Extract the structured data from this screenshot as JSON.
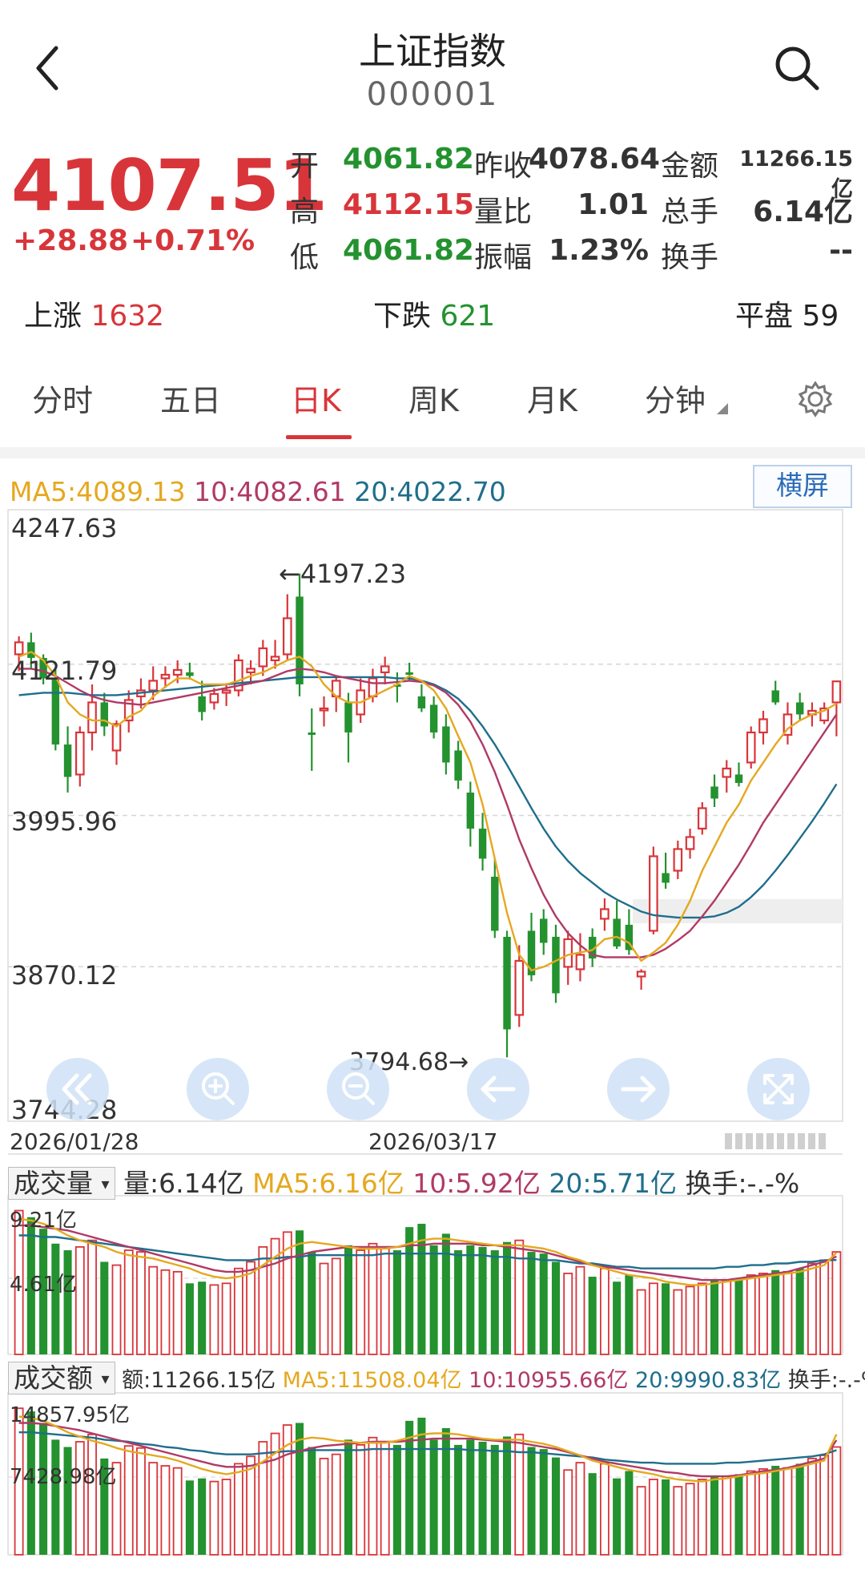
{
  "header": {
    "title": "上证指数",
    "code": "000001"
  },
  "quote": {
    "price": "4107.51",
    "change": "+28.88",
    "change_pct": "+0.71%",
    "rows": [
      {
        "l1": "开",
        "v1": "4061.82",
        "c1": "#23922f",
        "l2": "昨收",
        "v2": "4078.64",
        "l3": "金额",
        "v3": "11266.15亿"
      },
      {
        "l1": "高",
        "v1": "4112.15",
        "c1": "#d8353a",
        "l2": "量比",
        "v2": "1.01",
        "l3": "总手",
        "v3": "6.14亿"
      },
      {
        "l1": "低",
        "v1": "4061.82",
        "c1": "#23922f",
        "l2": "振幅",
        "v2": "1.23%",
        "l3": "换手",
        "v3": "--"
      }
    ]
  },
  "breadth": {
    "up_label": "上涨",
    "up_value": "1632",
    "down_label": "下跌",
    "down_value": "621",
    "flat_label": "平盘",
    "flat_value": "59"
  },
  "tabs": [
    "分时",
    "五日",
    "日K",
    "周K",
    "月K",
    "分钟"
  ],
  "active_tab": 2,
  "ma_legend": {
    "ma5": "MA5:4089.13",
    "ma10": "10:4082.61",
    "ma20": "20:4022.70",
    "landscape": "横屏"
  },
  "colors": {
    "up": "#d8353a",
    "down": "#23922f",
    "ma5": "#e5a81f",
    "ma10": "#b03a66",
    "ma20": "#1f6e8c",
    "accent": "#2c6bb8"
  },
  "icons": [
    "back-arrow-icon",
    "search-icon",
    "settings-gear-icon",
    "rewind-icon",
    "zoom-in-icon",
    "zoom-out-icon",
    "left-arrow-icon",
    "right-arrow-icon",
    "fullscreen-icon"
  ],
  "volume_legend": {
    "selector": "成交量",
    "vol": "量:6.14亿",
    "ma5": "MA5:6.16亿",
    "ma10": "10:5.92亿",
    "ma20": "20:5.71亿",
    "turnover": "换手:-.-%",
    "ymax": "9.21亿",
    "ymid": "4.61亿"
  },
  "amount_legend": {
    "selector": "成交额",
    "amt": "额:11266.15亿",
    "ma5": "MA5:11508.04亿",
    "ma10": "10:10955.66亿",
    "ma20": "20:9990.83亿",
    "turnover": "换手:-.-%",
    "ymax": "14857.95亿",
    "ymid": "7428.98亿"
  },
  "chart_data": {
    "type": "candlestick",
    "y_ticks": [
      "4247.63",
      "4121.79",
      "3995.96",
      "3870.12",
      "3744.28"
    ],
    "ylim": [
      3744.28,
      4247.63
    ],
    "x_labels": [
      "2026/01/28",
      "2026/03/17"
    ],
    "annotations": {
      "high": "4197.23",
      "low": "3794.68"
    },
    "candles": [
      [
        4130,
        4145,
        4116,
        4140
      ],
      [
        4140,
        4148,
        4118,
        4127
      ],
      [
        4127,
        4130,
        4105,
        4110
      ],
      [
        4110,
        4118,
        4050,
        4055
      ],
      [
        4055,
        4070,
        4015,
        4028
      ],
      [
        4030,
        4070,
        4020,
        4065
      ],
      [
        4065,
        4105,
        4050,
        4090
      ],
      [
        4090,
        4098,
        4062,
        4070
      ],
      [
        4050,
        4075,
        4038,
        4072
      ],
      [
        4075,
        4100,
        4065,
        4092
      ],
      [
        4095,
        4110,
        4085,
        4100
      ],
      [
        4100,
        4120,
        4092,
        4108
      ],
      [
        4110,
        4120,
        4102,
        4113
      ],
      [
        4113,
        4125,
        4106,
        4117
      ],
      [
        4115,
        4123,
        4109,
        4112
      ],
      [
        4095,
        4108,
        4075,
        4082
      ],
      [
        4090,
        4102,
        4084,
        4097
      ],
      [
        4098,
        4106,
        4087,
        4100
      ],
      [
        4100,
        4130,
        4095,
        4125
      ],
      [
        4115,
        4125,
        4105,
        4118
      ],
      [
        4120,
        4142,
        4112,
        4135
      ],
      [
        4125,
        4142,
        4118,
        4128
      ],
      [
        4130,
        4180,
        4125,
        4160
      ],
      [
        4178,
        4197.23,
        4095,
        4105
      ],
      [
        4065,
        4085,
        4033,
        4063
      ],
      [
        4085,
        4095,
        4070,
        4085
      ],
      [
        4095,
        4112,
        4082,
        4108
      ],
      [
        4090,
        4098,
        4040,
        4065
      ],
      [
        4080,
        4110,
        4073,
        4100
      ],
      [
        4095,
        4118,
        4090,
        4110
      ],
      [
        4115,
        4128,
        4105,
        4120
      ],
      [
        4105,
        4115,
        4090,
        4103
      ],
      [
        4115,
        4123,
        4108,
        4113
      ],
      [
        4095,
        4105,
        4082,
        4085
      ],
      [
        4088,
        4095,
        4060,
        4065
      ],
      [
        4070,
        4080,
        4030,
        4040
      ],
      [
        4050,
        4058,
        4018,
        4025
      ],
      [
        4015,
        4024,
        3970,
        3985
      ],
      [
        3985,
        3998,
        3950,
        3960
      ],
      [
        3945,
        3960,
        3894,
        3900
      ],
      [
        3895,
        3900,
        3794.68,
        3818
      ],
      [
        3830,
        3888,
        3820,
        3875
      ],
      [
        3900,
        3915,
        3858,
        3863
      ],
      [
        3910,
        3918,
        3880,
        3890
      ],
      [
        3895,
        3905,
        3840,
        3848
      ],
      [
        3870,
        3900,
        3855,
        3893
      ],
      [
        3868,
        3898,
        3858,
        3880
      ],
      [
        3895,
        3902,
        3870,
        3877
      ],
      [
        3910,
        3927,
        3900,
        3918
      ],
      [
        3910,
        3925,
        3885,
        3887
      ],
      [
        3905,
        3918,
        3880,
        3884
      ],
      [
        3862,
        3868,
        3851,
        3866
      ],
      [
        3900,
        3970,
        3897,
        3962
      ],
      [
        3948,
        3965,
        3935,
        3940
      ],
      [
        3950,
        3975,
        3943,
        3968
      ],
      [
        3968,
        3985,
        3960,
        3978
      ],
      [
        3985,
        4007,
        3980,
        4002
      ],
      [
        4020,
        4030,
        4003,
        4010
      ],
      [
        4028,
        4042,
        4015,
        4035
      ],
      [
        4030,
        4040,
        4020,
        4023
      ],
      [
        4040,
        4070,
        4035,
        4065
      ],
      [
        4065,
        4083,
        4055,
        4076
      ],
      [
        4100,
        4108,
        4088,
        4090
      ],
      [
        4063,
        4090,
        4055,
        4080
      ],
      [
        4090,
        4098,
        4075,
        4080
      ],
      [
        4080,
        4090,
        4070,
        4083
      ],
      [
        4075,
        4090,
        4072,
        4085
      ],
      [
        4090,
        4104,
        4061.82,
        4107.51
      ]
    ],
    "ma5": [
      4128,
      4132,
      4125,
      4112,
      4090,
      4080,
      4075,
      4075,
      4070,
      4078,
      4083,
      4095,
      4103,
      4110,
      4110,
      4105,
      4105,
      4105,
      4108,
      4112,
      4115,
      4120,
      4125,
      4128,
      4120,
      4105,
      4095,
      4090,
      4090,
      4095,
      4100,
      4105,
      4112,
      4108,
      4100,
      4085,
      4062,
      4040,
      4005,
      3960,
      3915,
      3880,
      3867,
      3870,
      3875,
      3880,
      3882,
      3884,
      3893,
      3895,
      3890,
      3875,
      3882,
      3890,
      3905,
      3925,
      3950,
      3970,
      3990,
      4005,
      4025,
      4040,
      4055,
      4068,
      4075,
      4080,
      4083,
      4089
    ],
    "ma10": [
      4118,
      4118,
      4116,
      4112,
      4106,
      4100,
      4095,
      4092,
      4090,
      4089,
      4088,
      4090,
      4092,
      4094,
      4096,
      4098,
      4100,
      4102,
      4104,
      4106,
      4108,
      4112,
      4116,
      4118,
      4117,
      4115,
      4112,
      4110,
      4108,
      4106,
      4106,
      4107,
      4108,
      4107,
      4104,
      4098,
      4088,
      4074,
      4055,
      4032,
      4005,
      3976,
      3952,
      3930,
      3912,
      3898,
      3888,
      3880,
      3878,
      3878,
      3878,
      3878,
      3880,
      3885,
      3892,
      3900,
      3912,
      3925,
      3940,
      3955,
      3972,
      3990,
      4005,
      4020,
      4035,
      4050,
      4065,
      4080
    ],
    "ma20": [
      4096,
      4097,
      4098,
      4098,
      4098,
      4097,
      4096,
      4096,
      4096,
      4097,
      4098,
      4099,
      4100,
      4101,
      4102,
      4103,
      4104,
      4105,
      4106,
      4107,
      4108,
      4109,
      4110,
      4111,
      4111,
      4111,
      4111,
      4111,
      4111,
      4111,
      4111,
      4110,
      4110,
      4108,
      4105,
      4100,
      4093,
      4083,
      4070,
      4055,
      4038,
      4020,
      4002,
      3985,
      3970,
      3958,
      3948,
      3940,
      3932,
      3926,
      3921,
      3916,
      3913,
      3912,
      3911,
      3911,
      3911,
      3912,
      3915,
      3920,
      3928,
      3938,
      3950,
      3963,
      3977,
      3991,
      4006,
      4022
    ],
    "volume": {
      "ylim": [
        0,
        9.21
      ],
      "ticks": [
        "9.21亿",
        "4.61亿"
      ],
      "values": [
        8.7,
        8.3,
        7.6,
        6.7,
        6.3,
        6.5,
        6.9,
        5.6,
        5.4,
        6.3,
        6.2,
        5.3,
        5.1,
        5.0,
        4.3,
        4.4,
        4.2,
        4.3,
        5.2,
        5.6,
        6.5,
        7.0,
        7.4,
        7.5,
        6.2,
        5.5,
        5.8,
        6.6,
        6.3,
        6.7,
        6.5,
        6.3,
        7.7,
        7.9,
        6.6,
        7.3,
        6.3,
        6.6,
        6.5,
        6.3,
        6.8,
        6.9,
        6.2,
        6.1,
        5.6,
        4.9,
        5.3,
        4.7,
        5.2,
        4.4,
        4.8,
        3.9,
        4.3,
        4.3,
        3.9,
        4.1,
        4.3,
        4.5,
        4.5,
        4.6,
        4.8,
        4.9,
        5.1,
        5.0,
        5.2,
        5.5,
        5.7,
        6.2
      ],
      "ma5": [
        8.2,
        8.1,
        7.9,
        7.6,
        7.2,
        6.9,
        6.7,
        6.5,
        6.2,
        6.0,
        5.9,
        5.8,
        5.6,
        5.4,
        5.2,
        4.9,
        4.7,
        4.6,
        4.7,
        4.9,
        5.4,
        5.9,
        6.4,
        6.7,
        6.8,
        6.7,
        6.6,
        6.5,
        6.4,
        6.4,
        6.4,
        6.5,
        6.7,
        6.9,
        7.0,
        7.0,
        6.9,
        6.8,
        6.7,
        6.6,
        6.6,
        6.6,
        6.5,
        6.4,
        6.2,
        5.9,
        5.7,
        5.4,
        5.2,
        5.0,
        4.8,
        4.7,
        4.6,
        4.4,
        4.3,
        4.2,
        4.2,
        4.3,
        4.4,
        4.5,
        4.6,
        4.7,
        4.8,
        4.9,
        5.0,
        5.2,
        5.4,
        6.16
      ],
      "ma10": [
        7.8,
        7.8,
        7.7,
        7.6,
        7.5,
        7.3,
        7.1,
        6.9,
        6.7,
        6.5,
        6.3,
        6.1,
        5.9,
        5.7,
        5.5,
        5.3,
        5.1,
        5.0,
        5.0,
        5.1,
        5.3,
        5.5,
        5.8,
        6.0,
        6.2,
        6.3,
        6.4,
        6.5,
        6.5,
        6.5,
        6.5,
        6.5,
        6.6,
        6.6,
        6.7,
        6.7,
        6.7,
        6.7,
        6.6,
        6.6,
        6.5,
        6.4,
        6.3,
        6.2,
        6.0,
        5.8,
        5.6,
        5.4,
        5.3,
        5.2,
        5.1,
        5.0,
        4.9,
        4.8,
        4.7,
        4.6,
        4.5,
        4.5,
        4.5,
        4.6,
        4.7,
        4.8,
        4.9,
        5.0,
        5.2,
        5.4,
        5.6,
        5.92
      ],
      "ma20": [
        7.2,
        7.2,
        7.1,
        7.1,
        7.0,
        6.9,
        6.8,
        6.7,
        6.6,
        6.5,
        6.4,
        6.3,
        6.2,
        6.1,
        6.0,
        5.9,
        5.8,
        5.7,
        5.7,
        5.7,
        5.8,
        5.8,
        5.9,
        5.9,
        6.0,
        6.0,
        6.0,
        6.0,
        6.0,
        6.0,
        6.1,
        6.1,
        6.1,
        6.1,
        6.1,
        6.1,
        6.0,
        6.0,
        6.0,
        5.9,
        5.9,
        5.8,
        5.8,
        5.7,
        5.7,
        5.6,
        5.5,
        5.5,
        5.4,
        5.3,
        5.3,
        5.2,
        5.2,
        5.2,
        5.2,
        5.2,
        5.2,
        5.2,
        5.3,
        5.3,
        5.4,
        5.4,
        5.5,
        5.5,
        5.6,
        5.6,
        5.7,
        5.71
      ]
    },
    "amount": {
      "ylim": [
        0,
        14857.95
      ],
      "ticks": [
        "14857.95亿",
        "7428.98亿"
      ],
      "values": [
        14000,
        13700,
        12600,
        11000,
        10300,
        10800,
        11500,
        9200,
        8800,
        10400,
        10200,
        8800,
        8500,
        8300,
        7100,
        7300,
        7000,
        7200,
        8700,
        9400,
        10800,
        11600,
        12400,
        12600,
        10300,
        9200,
        9600,
        11000,
        10500,
        11200,
        10800,
        10500,
        12800,
        13100,
        11000,
        12100,
        10500,
        11000,
        10800,
        10500,
        11300,
        11500,
        10300,
        10100,
        9300,
        8100,
        8800,
        7800,
        8700,
        7300,
        8000,
        6500,
        7200,
        7200,
        6500,
        6800,
        7200,
        7500,
        7500,
        7700,
        8000,
        8200,
        8500,
        8300,
        8700,
        9200,
        9500,
        10300
      ],
      "ma5": [
        13200,
        13100,
        12800,
        12300,
        11700,
        11300,
        10900,
        10600,
        10200,
        9900,
        9700,
        9500,
        9300,
        9000,
        8600,
        8200,
        7900,
        7700,
        7900,
        8200,
        8900,
        9700,
        10500,
        11000,
        11200,
        11100,
        10900,
        10800,
        10700,
        10700,
        10700,
        10900,
        11200,
        11500,
        11600,
        11600,
        11500,
        11300,
        11100,
        11000,
        11000,
        11000,
        10800,
        10600,
        10300,
        9900,
        9500,
        9000,
        8700,
        8400,
        8100,
        7900,
        7700,
        7400,
        7200,
        7100,
        7000,
        7200,
        7300,
        7500,
        7700,
        7800,
        8000,
        8200,
        8400,
        8700,
        9000,
        11508.04
      ],
      "ma10": [
        12600,
        12600,
        12500,
        12300,
        12100,
        11900,
        11600,
        11300,
        11000,
        10700,
        10400,
        10100,
        9800,
        9500,
        9200,
        8900,
        8600,
        8400,
        8400,
        8500,
        8800,
        9100,
        9600,
        9900,
        10200,
        10400,
        10500,
        10600,
        10700,
        10800,
        10800,
        10800,
        10900,
        11000,
        11100,
        11100,
        11100,
        11100,
        11000,
        10900,
        10800,
        10700,
        10500,
        10300,
        10100,
        9800,
        9500,
        9200,
        8900,
        8700,
        8500,
        8300,
        8100,
        7900,
        7800,
        7600,
        7500,
        7500,
        7500,
        7600,
        7800,
        8000,
        8100,
        8300,
        8600,
        8900,
        9200,
        10955.66
      ],
      "ma20": [
        11700,
        11700,
        11600,
        11500,
        11400,
        11300,
        11200,
        11000,
        10900,
        10800,
        10600,
        10500,
        10300,
        10200,
        10000,
        9900,
        9700,
        9600,
        9600,
        9600,
        9700,
        9800,
        9900,
        9900,
        10000,
        10000,
        10000,
        10000,
        10000,
        10100,
        10100,
        10100,
        10100,
        10100,
        10100,
        10100,
        10100,
        10000,
        10000,
        9900,
        9900,
        9800,
        9800,
        9700,
        9600,
        9500,
        9400,
        9300,
        9100,
        9000,
        8900,
        8800,
        8800,
        8700,
        8700,
        8700,
        8700,
        8700,
        8800,
        8800,
        8900,
        9000,
        9100,
        9200,
        9300,
        9400,
        9600,
        9990.83
      ]
    }
  }
}
